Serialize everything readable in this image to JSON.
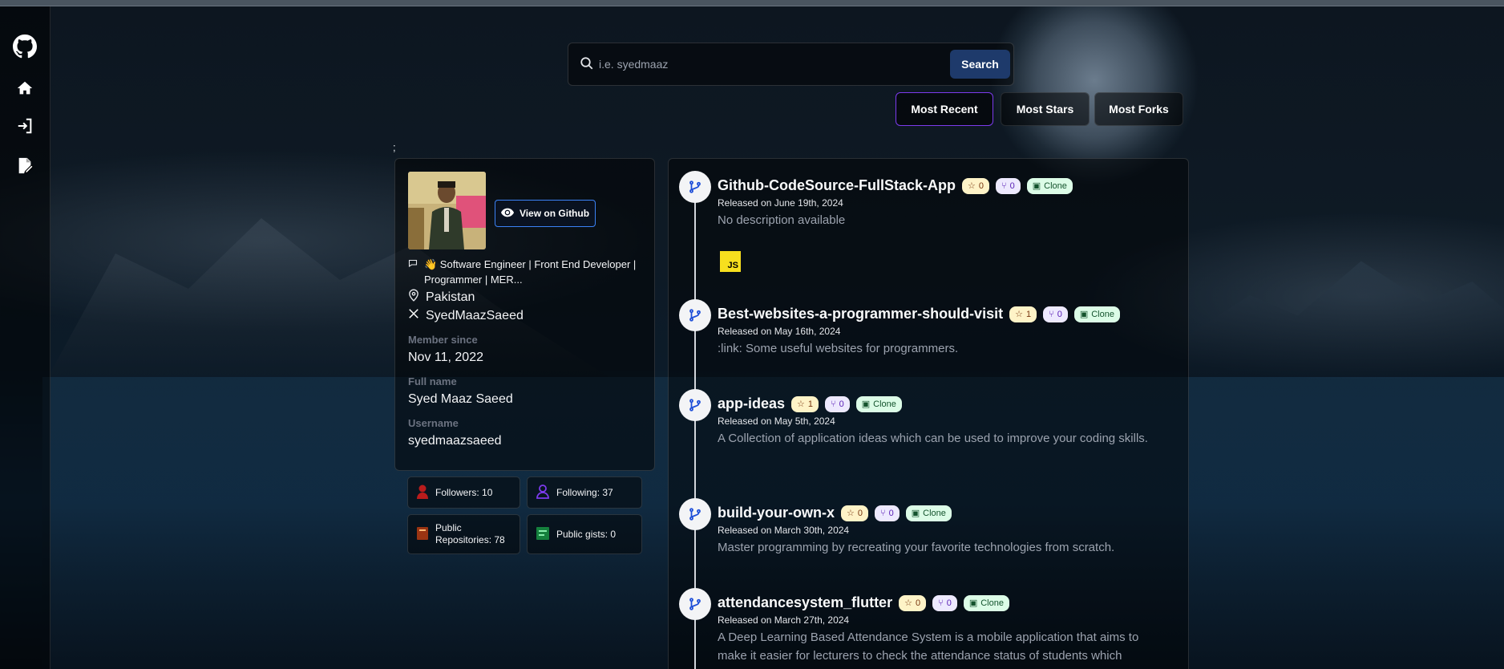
{
  "search": {
    "placeholder": "i.e. syedmaaz",
    "button_label": "Search"
  },
  "sort": {
    "most_recent": "Most Recent",
    "most_stars": "Most Stars",
    "most_forks": "Most Forks",
    "active": "Most Recent"
  },
  "stray_text": ";",
  "profile": {
    "view_label": "View on Github",
    "bio": "👋 Software Engineer | Front End Developer | Programmer | MER...",
    "location": "Pakistan",
    "twitter": "SyedMaazSaeed",
    "member_since_label": "Member since",
    "member_since": "Nov 11, 2022",
    "full_name_label": "Full name",
    "full_name": "Syed Maaz Saeed",
    "username_label": "Username",
    "username": "syedmaazsaeed"
  },
  "stats": {
    "followers": "Followers: 10",
    "following": "Following: 37",
    "public_repos": "Public Repositories: 78",
    "public_gists": "Public gists: 0"
  },
  "repos": [
    {
      "name": "Github-CodeSource-FullStack-App",
      "stars": "0",
      "forks": "0",
      "clone": "Clone",
      "date": "Released on June 19th, 2024",
      "description": "No description available",
      "language": "JS"
    },
    {
      "name": "Best-websites-a-programmer-should-visit",
      "stars": "1",
      "forks": "0",
      "clone": "Clone",
      "date": "Released on May 16th, 2024",
      "description": ":link: Some useful websites for programmers."
    },
    {
      "name": "app-ideas",
      "stars": "1",
      "forks": "0",
      "clone": "Clone",
      "date": "Released on May 5th, 2024",
      "description": "A Collection of application ideas which can be used to improve your coding skills."
    },
    {
      "name": "build-your-own-x",
      "stars": "0",
      "forks": "0",
      "clone": "Clone",
      "date": "Released on March 30th, 2024",
      "description": "Master programming by recreating your favorite technologies from scratch."
    },
    {
      "name": "attendancesystem_flutter",
      "stars": "0",
      "forks": "0",
      "clone": "Clone",
      "date": "Released on March 27th, 2024",
      "description": "A Deep Learning Based Attendance System is a mobile application that aims to make it easier for lecturers to check the attendance status of students which"
    }
  ],
  "colors": {
    "accent": "#7c3aed",
    "search_button": "#1e3a6b",
    "star_badge": "#fef3c7",
    "fork_badge": "#ede9fe",
    "clone_badge": "#dcfce7"
  }
}
